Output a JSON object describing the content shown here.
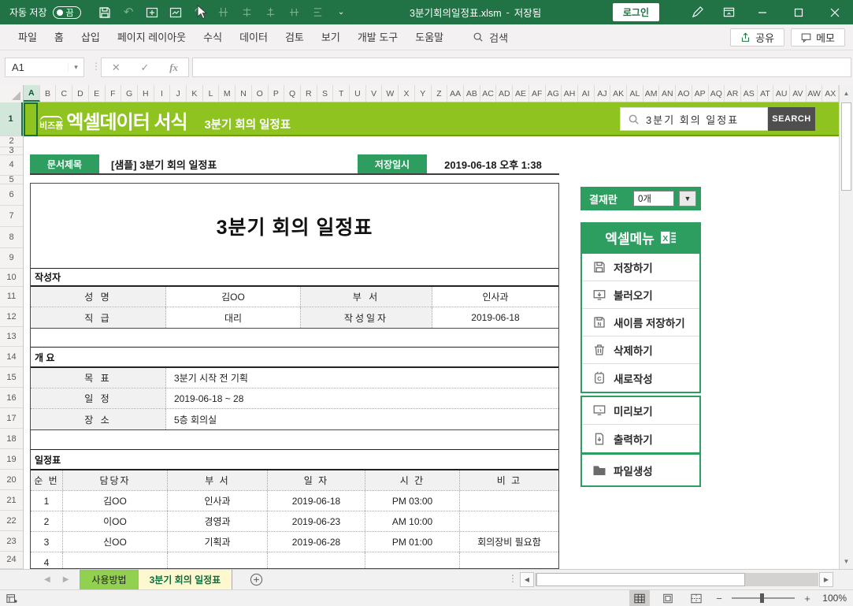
{
  "colors": {
    "excel_green": "#217346",
    "banner_green": "#8fc31f",
    "accent_green": "#2e9d60",
    "tab_green": "#92d050",
    "active_tab_cream": "#fdf8d0"
  },
  "titlebar": {
    "autosave_label": "자동 저장",
    "autosave_state": "끔",
    "filename": "3분기회의일정표.xlsm",
    "separator": "-",
    "save_status": "저장됨",
    "login_label": "로그인"
  },
  "ribbon": {
    "tabs": [
      "파일",
      "홈",
      "삽입",
      "페이지 레이아웃",
      "수식",
      "데이터",
      "검토",
      "보기",
      "개발 도구",
      "도움말"
    ],
    "search_label": "검색",
    "share_label": "공유",
    "memo_label": "메모"
  },
  "formula_bar": {
    "name_box_value": "A1",
    "fx_label": "fx"
  },
  "grid": {
    "columns": [
      "A",
      "B",
      "C",
      "D",
      "E",
      "F",
      "G",
      "H",
      "I",
      "J",
      "K",
      "L",
      "M",
      "N",
      "O",
      "P",
      "Q",
      "R",
      "S",
      "T",
      "U",
      "V",
      "W",
      "X",
      "Y",
      "Z",
      "AA",
      "AB",
      "AC",
      "AD",
      "AE",
      "AF",
      "AG",
      "AH",
      "AI",
      "AJ",
      "AK",
      "AL",
      "AM",
      "AN",
      "AO",
      "AP",
      "AQ",
      "AR",
      "AS",
      "AT",
      "AU",
      "AV",
      "AW",
      "AX"
    ],
    "rows": [
      "1",
      "2",
      "3",
      "4",
      "5",
      "6",
      "7",
      "8",
      "9",
      "10",
      "11",
      "12",
      "13",
      "14",
      "15",
      "16",
      "17",
      "18",
      "19",
      "20",
      "21",
      "22",
      "23",
      "24"
    ]
  },
  "banner": {
    "brand_small": "비즈폼",
    "brand_large": "엑셀데이터 서식",
    "subtitle": "3분기 회의 일정표",
    "search_value": "3분기 회의 일정표",
    "search_button_label": "SEARCH"
  },
  "doc_header": {
    "title_label": "문서제목",
    "title_value": "[샘플] 3분기 회의 일정표",
    "saved_label": "저장일시",
    "saved_value": "2019-06-18  오후 1:38"
  },
  "document": {
    "title": "3분기 회의 일정표",
    "writer_section": {
      "heading": "작성자",
      "rows": [
        [
          "성 명",
          "김OO",
          "부 서",
          "인사과"
        ],
        [
          "직 급",
          "대리",
          "작성일자",
          "2019-06-18"
        ]
      ]
    },
    "overview_section": {
      "heading": "개 요",
      "rows": [
        [
          "목 표",
          "3분기 시작 전 기획"
        ],
        [
          "일 정",
          "2019-06-18 ~ 28"
        ],
        [
          "장 소",
          "5층 회의실"
        ]
      ]
    },
    "schedule_section": {
      "heading": "일정표",
      "headers": [
        "순 번",
        "담당자",
        "부 서",
        "일 자",
        "시 간",
        "비 고"
      ],
      "rows": [
        [
          "1",
          "김OO",
          "인사과",
          "2019-06-18",
          "PM 03:00",
          ""
        ],
        [
          "2",
          "이OO",
          "경영과",
          "2019-06-23",
          "AM 10:00",
          ""
        ],
        [
          "3",
          "신OO",
          "기획과",
          "2019-06-28",
          "PM 01:00",
          "회의장비 필요함"
        ],
        [
          "4",
          "",
          "",
          "",
          "",
          ""
        ]
      ]
    }
  },
  "sidebar": {
    "approval_label": "결재란",
    "approval_value": "0개",
    "menu_title": "엑셀메뉴",
    "items": [
      {
        "icon": "save-icon",
        "label": "저장하기"
      },
      {
        "icon": "load-icon",
        "label": "불러오기"
      },
      {
        "icon": "save-as-icon",
        "label": "새이름 저장하기"
      },
      {
        "icon": "delete-icon",
        "label": "삭제하기"
      },
      {
        "icon": "new-doc-icon",
        "label": "새로작성"
      },
      {
        "icon": "preview-icon",
        "label": "미리보기"
      },
      {
        "icon": "print-icon",
        "label": "출력하기"
      },
      {
        "icon": "file-create-icon",
        "label": "파일생성"
      }
    ]
  },
  "sheet_tabs": {
    "tabs": [
      "사용방법",
      "3분기 회의 일정표"
    ]
  },
  "status_bar": {
    "zoom_level": "100%"
  }
}
